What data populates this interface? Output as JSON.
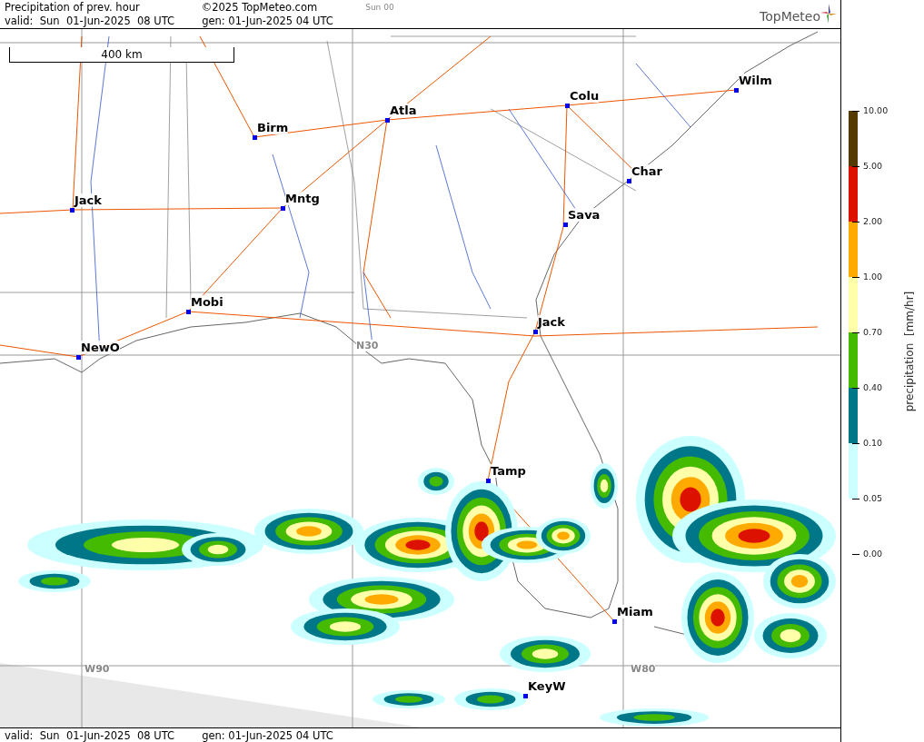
{
  "header": {
    "title": "Precipitation of prev. hour",
    "copyright": "©2025 TopMeteo.com",
    "run": "Sun 00",
    "valid": "valid:  Sun  01-Jun-2025  08 UTC",
    "gen": "gen: 01-Jun-2025 04 UTC"
  },
  "logo": {
    "text": "TopMeteo"
  },
  "map": {
    "scale": "400 km",
    "grid_labels": [
      "N30",
      "W90",
      "W80"
    ],
    "cities": [
      "Wilm",
      "Colu",
      "Atla",
      "Birm",
      "Char",
      "Jack",
      "Mntg",
      "Sava",
      "Mobi",
      "Jack",
      "NewO",
      "Tamp",
      "Miam",
      "KeyW"
    ]
  },
  "legend": {
    "title": "precipitation  [mm/hr]",
    "ticks": [
      "10.00",
      "5.00",
      "2.00",
      "1.00",
      "0.70",
      "0.40",
      "0.10",
      "0.05",
      "0.00"
    ],
    "bands": [
      {
        "color": "#553a00"
      },
      {
        "color": "#dd1100"
      },
      {
        "color": "#ffaa00"
      },
      {
        "color": "#ffffaa"
      },
      {
        "color": "#44bb00"
      },
      {
        "color": "#007788"
      },
      {
        "color": "#ccffff"
      }
    ]
  },
  "footer": {
    "valid": "valid:  Sun  01-Jun-2025  08 UTC",
    "gen": "gen: 01-Jun-2025 04 UTC"
  }
}
